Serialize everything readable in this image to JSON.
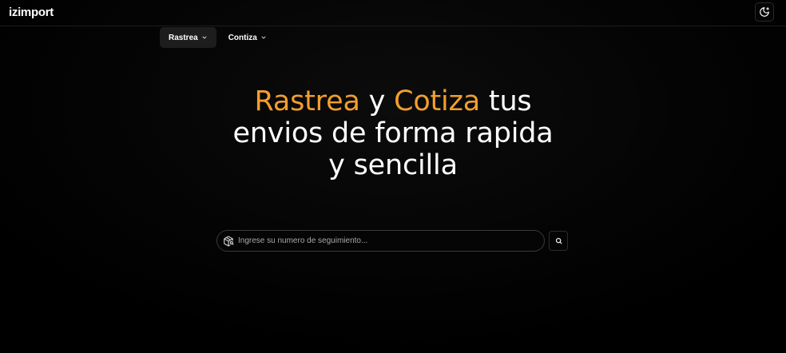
{
  "header": {
    "logo_text": "izimport",
    "theme_toggle_icon": "moon-sun-icon"
  },
  "nav": {
    "items": [
      {
        "label": "Rastrea",
        "icon": "chevron-down-icon",
        "active": true
      },
      {
        "label": "Contiza",
        "icon": "chevron-down-icon",
        "active": false
      }
    ]
  },
  "hero": {
    "word1": "Rastrea",
    "join": " y ",
    "word2": "Cotiza",
    "rest_line1": " tus",
    "line2": "envios de forma rapida",
    "line3": "y sencilla"
  },
  "search": {
    "placeholder": "Ingrese su numero de seguimiento...",
    "value": "",
    "input_icon": "package-search-icon",
    "button_icon": "search-icon"
  },
  "colors": {
    "background": "#000000",
    "accent": "#f29e2e",
    "text": "#ffffff",
    "border": "#3a3a3a"
  }
}
